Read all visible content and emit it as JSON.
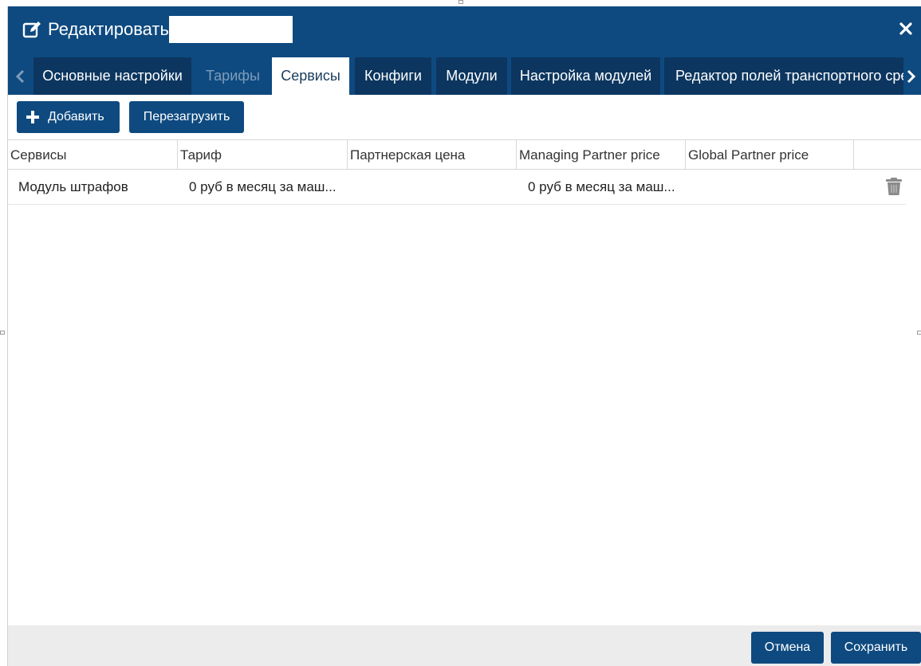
{
  "dialog": {
    "title": "Редактировать",
    "colors": {
      "header_bg": "#0e4a80",
      "tab_bg": "#0c3660",
      "active_tab_bg": "#ffffff"
    }
  },
  "icons": {
    "edit": "edit-icon",
    "close": "close-icon",
    "tabs_prev": "chevron-left-icon",
    "tabs_next": "chevron-right-icon",
    "add": "plus-icon",
    "delete": "trash-icon"
  },
  "tabs": [
    {
      "label": "Основные настройки",
      "state": "normal"
    },
    {
      "label": "Тарифы",
      "state": "disabled"
    },
    {
      "label": "Сервисы",
      "state": "active"
    },
    {
      "label": "Конфиги",
      "state": "normal"
    },
    {
      "label": "Модули",
      "state": "normal"
    },
    {
      "label": "Настройка модулей",
      "state": "normal"
    },
    {
      "label": "Редактор полей транспортного сре",
      "state": "normal"
    }
  ],
  "toolbar": {
    "add_label": "Добавить",
    "reload_label": "Перезагрузить"
  },
  "table": {
    "columns": [
      "Сервисы",
      "Тариф",
      "Партнерская цена",
      "Managing Partner price",
      "Global Partner price",
      ""
    ],
    "rows": [
      {
        "service": "Модуль штрафов",
        "tariff": "0 руб в месяц за маш...",
        "partner_price": "",
        "managing_partner_price": "0 руб в месяц за маш...",
        "global_partner_price": ""
      }
    ]
  },
  "footer": {
    "cancel_label": "Отмена",
    "save_label": "Сохранить"
  }
}
